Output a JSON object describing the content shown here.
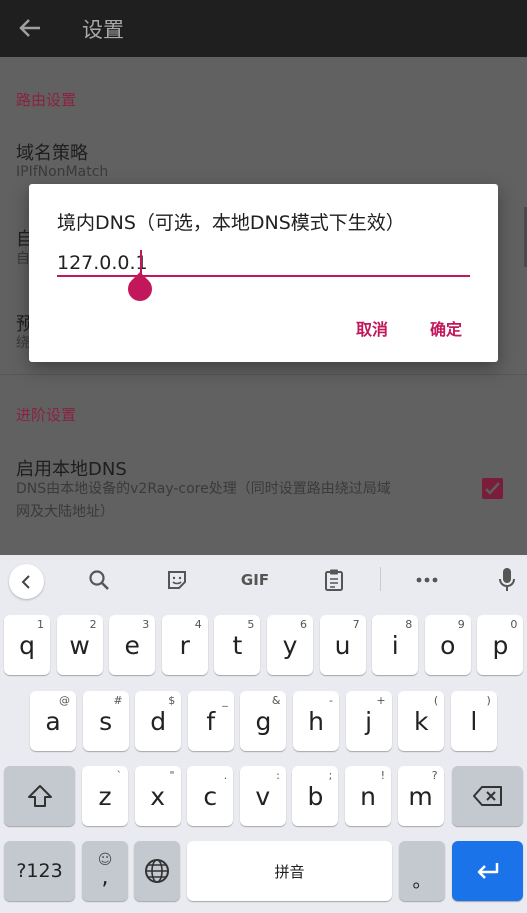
{
  "appbar": {
    "title": "设置",
    "back_icon": "arrow-back-icon"
  },
  "settings": {
    "routing_category": "路由设置",
    "domain_strategy_title": "域名策略",
    "domain_strategy_summary": "IPIfNonMatch",
    "item2_title": "自",
    "item2_summary": "自",
    "item3_title": "预",
    "item3_summary": "绕",
    "advanced_category": "进阶设置",
    "local_dns_title": "启用本地DNS",
    "local_dns_summary_line1": "DNS由本地设备的v2Ray-core处理（同时设置路由绕过局域",
    "local_dns_summary_line2": "网及大陆地址）",
    "local_dns_checked": true
  },
  "dialog": {
    "title": "境内DNS（可选，本地DNS模式下生效）",
    "input_value": "127.0.0.1",
    "cancel_label": "取消",
    "ok_label": "确定"
  },
  "keyboard": {
    "toolbar": {
      "gif_label": "GIF",
      "icons": [
        "chevron-left-icon",
        "search-icon",
        "sticker-icon",
        "gif-icon",
        "clipboard-icon",
        "more-icon",
        "mic-icon"
      ]
    },
    "row1": [
      {
        "k": "q",
        "h": "1"
      },
      {
        "k": "w",
        "h": "2"
      },
      {
        "k": "e",
        "h": "3"
      },
      {
        "k": "r",
        "h": "4"
      },
      {
        "k": "t",
        "h": "5"
      },
      {
        "k": "y",
        "h": "6"
      },
      {
        "k": "u",
        "h": "7"
      },
      {
        "k": "i",
        "h": "8"
      },
      {
        "k": "o",
        "h": "9"
      },
      {
        "k": "p",
        "h": "0"
      }
    ],
    "row2": [
      {
        "k": "a",
        "h": "@"
      },
      {
        "k": "s",
        "h": "#"
      },
      {
        "k": "d",
        "h": "$"
      },
      {
        "k": "f",
        "h": "_"
      },
      {
        "k": "g",
        "h": "&"
      },
      {
        "k": "h",
        "h": "-"
      },
      {
        "k": "j",
        "h": "+"
      },
      {
        "k": "k",
        "h": "("
      },
      {
        "k": "l",
        "h": ")"
      }
    ],
    "row3": [
      {
        "k": "z",
        "h": "`"
      },
      {
        "k": "x",
        "h": "\""
      },
      {
        "k": "c",
        "h": "."
      },
      {
        "k": "v",
        "h": ":"
      },
      {
        "k": "b",
        "h": ";"
      },
      {
        "k": "n",
        "h": "!"
      },
      {
        "k": "m",
        "h": "?"
      }
    ],
    "symbols_label": "?123",
    "comma_label": ",",
    "emoji_hint": "☺",
    "space_label": "拼音",
    "period_label": "。",
    "accent_color": "#c2185b",
    "enter_color": "#1a73e8"
  }
}
